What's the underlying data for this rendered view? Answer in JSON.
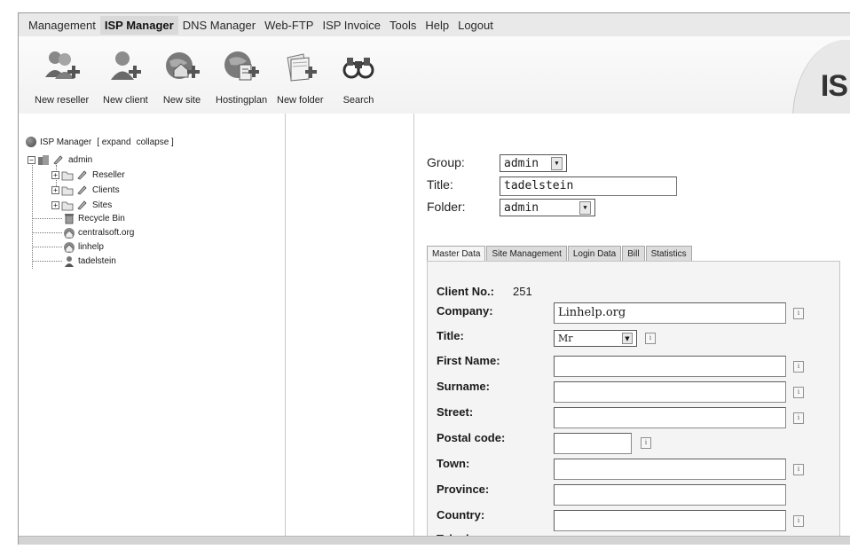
{
  "menu": {
    "items": [
      "Management",
      "ISP Manager",
      "DNS Manager",
      "Web-FTP",
      "ISP Invoice",
      "Tools",
      "Help",
      "Logout"
    ],
    "active_index": 1
  },
  "toolbar": {
    "new_reseller": "New reseller",
    "new_client": "New client",
    "new_site": "New site",
    "hostingplan": "Hostingplan",
    "new_folder": "New folder",
    "search": "Search",
    "logo_text": "IS"
  },
  "tree": {
    "root_label": "ISP Manager",
    "expand_label": "expand",
    "collapse_label": "collapse",
    "admin": "admin",
    "reseller": "Reseller",
    "clients": "Clients",
    "sites": "Sites",
    "recycle_bin": "Recycle Bin",
    "centralsoft": "centralsoft.org",
    "linhelp": "linhelp",
    "tadelstein": "tadelstein"
  },
  "form": {
    "group_label": "Group:",
    "group_value": "admin",
    "title_label": "Title:",
    "title_value": "tadelstein",
    "folder_label": "Folder:",
    "folder_value": "admin"
  },
  "tabs": [
    "Master Data",
    "Site Management",
    "Login Data",
    "Bill",
    "Statistics"
  ],
  "master_data": {
    "client_no_label": "Client No.:",
    "client_no_value": "251",
    "company_label": "Company:",
    "company_value": "Linhelp.org",
    "title_label": "Title:",
    "title_value": "Mr",
    "first_name_label": "First Name:",
    "surname_label": "Surname:",
    "street_label": "Street:",
    "postal_code_label": "Postal code:",
    "town_label": "Town:",
    "province_label": "Province:",
    "country_label": "Country:",
    "telephone_label": "Telephone:"
  }
}
